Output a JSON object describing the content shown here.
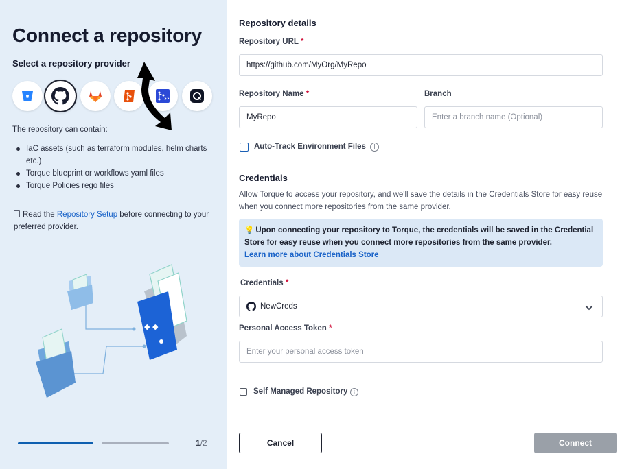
{
  "left": {
    "title": "Connect a repository",
    "subtitle": "Select a repository provider",
    "providers": [
      {
        "name": "Bitbucket",
        "icon": "bitbucket-icon",
        "color": "#2684ff"
      },
      {
        "name": "GitHub",
        "icon": "github-icon",
        "color": "#161b2e",
        "selected": true
      },
      {
        "name": "GitLab",
        "icon": "gitlab-icon",
        "color": "#e24329"
      },
      {
        "name": "Git",
        "icon": "git-icon",
        "color": "#e8510c"
      },
      {
        "name": "Azure Repos",
        "icon": "azure-repos-icon",
        "color": "#2b49d6"
      },
      {
        "name": "Other",
        "icon": "other-provider-icon",
        "color": "#0f1424"
      }
    ],
    "intro": "The repository can contain:",
    "bullets": [
      "IaC assets (such as terraform modules, helm charts etc.)",
      "Torque blueprint or workflows yaml files",
      "Torque Policies rego files"
    ],
    "setup_note_prefix": "Read the ",
    "setup_note_link": "Repository Setup",
    "setup_note_suffix": " before connecting to your preferred provider.",
    "step_current": "1",
    "step_total": "/2"
  },
  "form": {
    "details_title": "Repository details",
    "url_label": "Repository URL",
    "url_value": "https://github.com/MyOrg/MyRepo",
    "name_label": "Repository Name",
    "name_value": "MyRepo",
    "branch_label": "Branch",
    "branch_placeholder": "Enter a branch name (Optional)",
    "auto_track_label": "Auto-Track Environment Files",
    "credentials_title": "Credentials",
    "credentials_desc": "Allow Torque to access your repository, and we'll save the details in the Credentials Store for easy reuse when you connect more repositories from the same provider.",
    "notice_text": "Upon connecting your repository to Torque, the credentials will be saved in the Credential Store for easy reuse when you connect more repositories from the same provider.",
    "notice_link": "Learn more about Credentials Store",
    "credentials_label": "Credentials",
    "credentials_value": "NewCreds",
    "token_label": "Personal Access Token",
    "token_placeholder": "Enter your personal access token",
    "self_managed_label": "Self Managed Repository",
    "required_mark": "*",
    "cancel_label": "Cancel",
    "connect_label": "Connect"
  },
  "colors": {
    "left_bg": "#e4eef8",
    "link": "#1a63c8",
    "required": "#d0103a",
    "notice_bg": "#dbe8f6",
    "connect_disabled": "#9aa0a8",
    "progress_active": "#0e5fb0"
  }
}
